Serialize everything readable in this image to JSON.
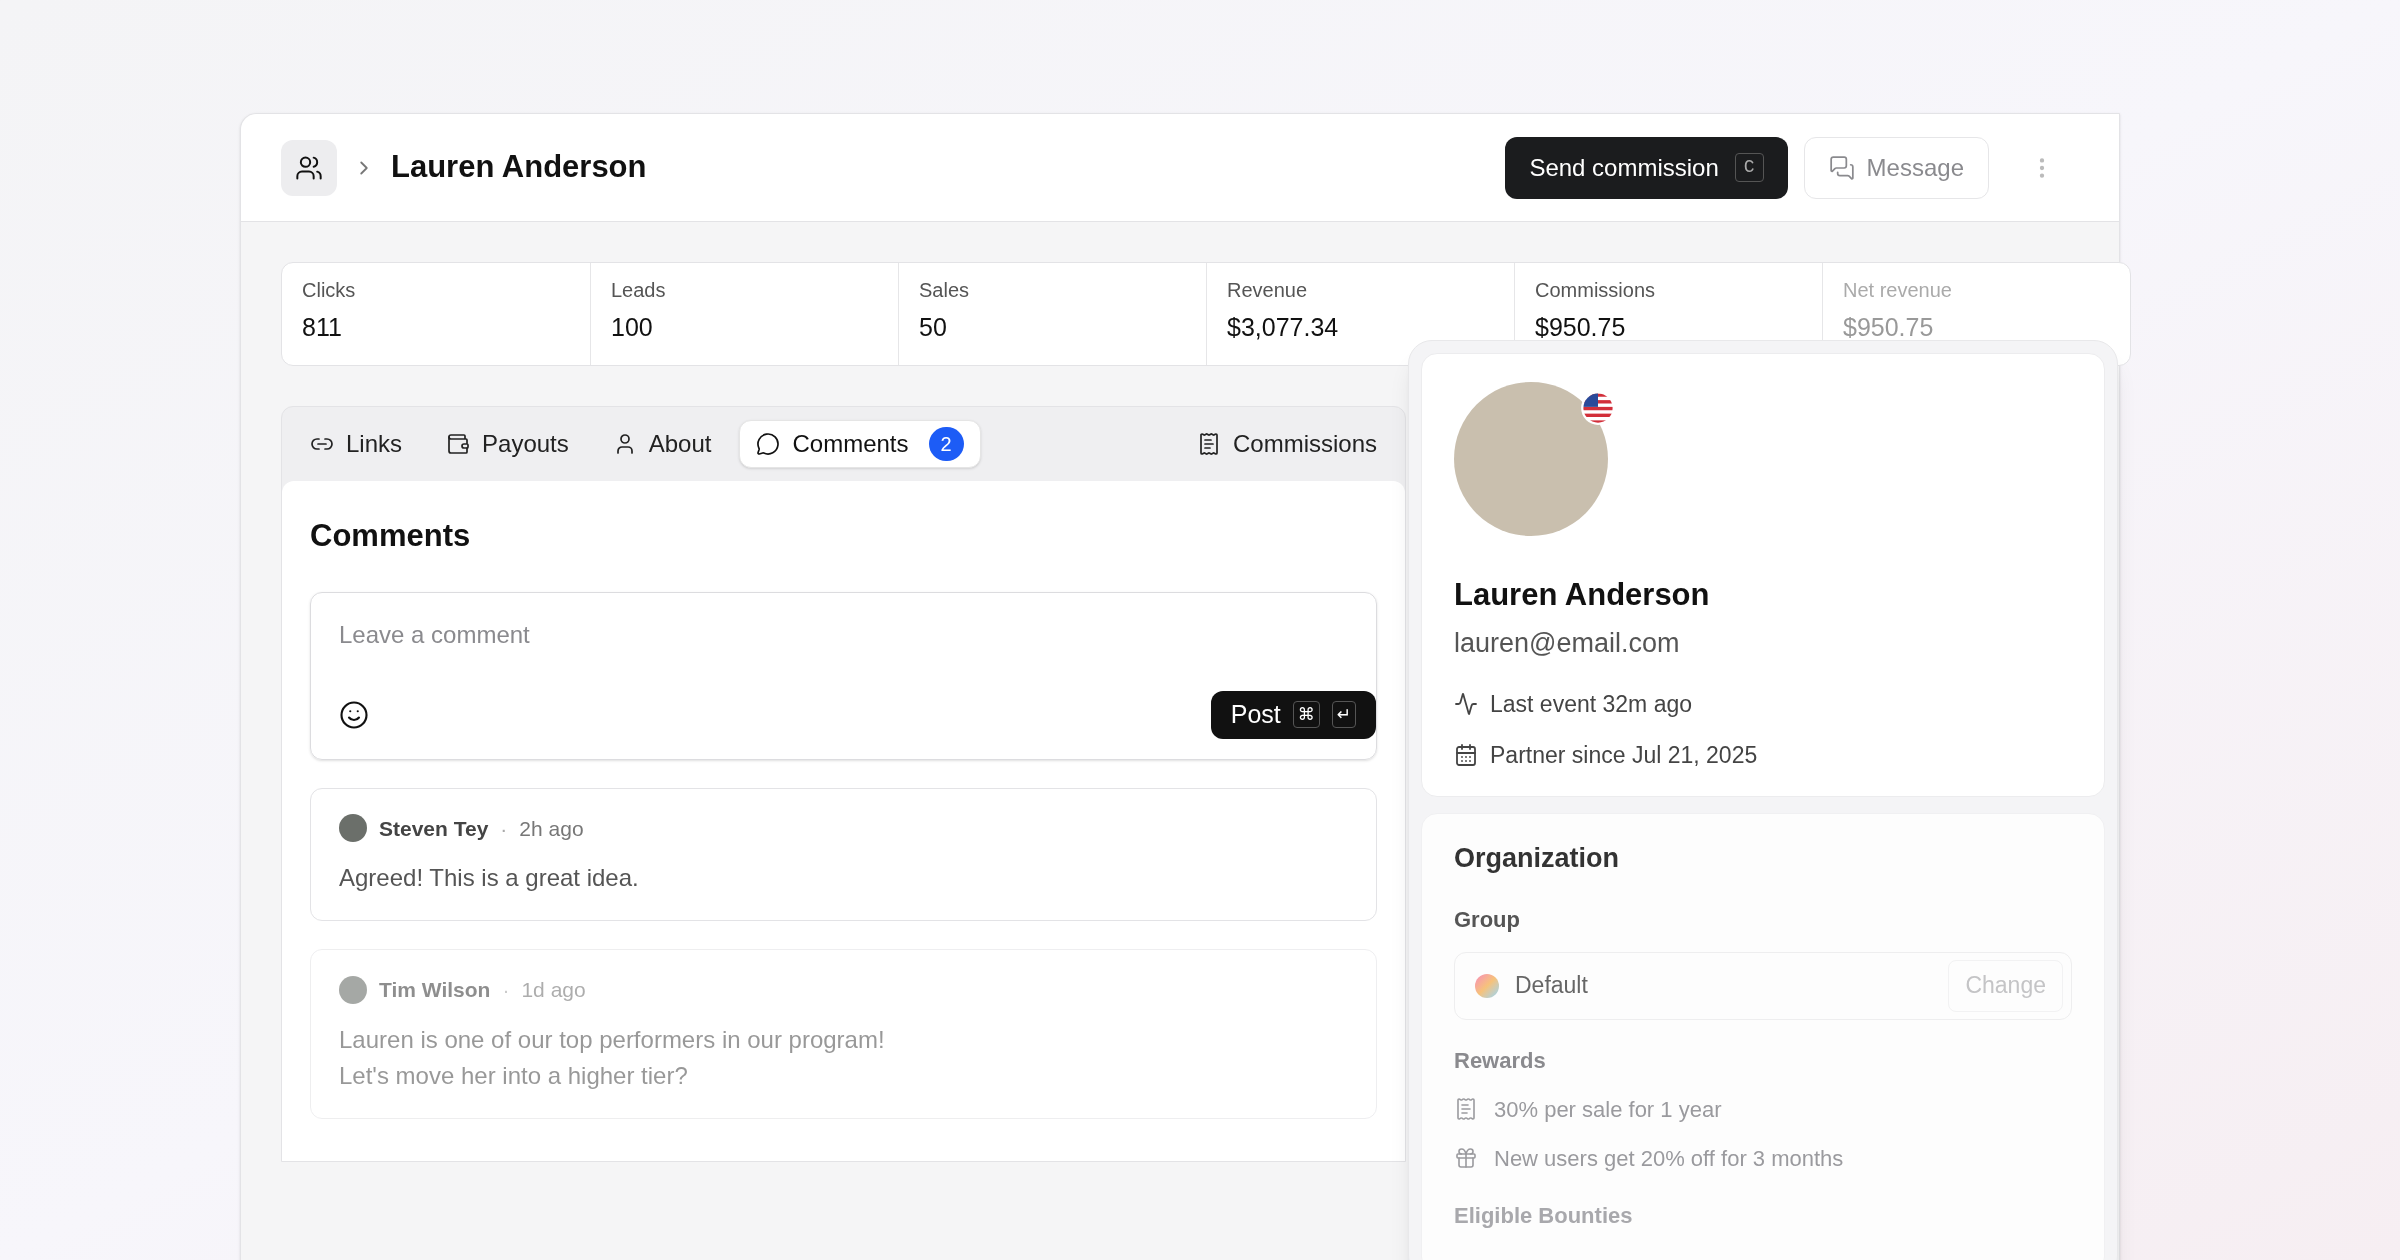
{
  "header": {
    "breadcrumb_title": "Lauren Anderson",
    "primary_button": {
      "label": "Send commission",
      "shortcut": "C"
    },
    "secondary_button": {
      "label": "Message"
    }
  },
  "stats": [
    {
      "label": "Clicks",
      "value": "811"
    },
    {
      "label": "Leads",
      "value": "100"
    },
    {
      "label": "Sales",
      "value": "50"
    },
    {
      "label": "Revenue",
      "value": "$3,077.34"
    },
    {
      "label": "Commissions",
      "value": "$950.75"
    },
    {
      "label": "Net revenue",
      "value": "$950.75"
    }
  ],
  "tabs": [
    {
      "kind": "links",
      "label": "Links",
      "selected": false
    },
    {
      "kind": "payouts",
      "label": "Payouts",
      "selected": false
    },
    {
      "kind": "about",
      "label": "About",
      "selected": false
    },
    {
      "kind": "comments",
      "label": "Comments",
      "badge": "2",
      "selected": true
    },
    {
      "kind": "commissions",
      "label": "Commissions",
      "selected": false
    }
  ],
  "comments_section": {
    "title": "Comments",
    "composer": {
      "placeholder": "Leave a comment",
      "post_label": "Post",
      "shortcut_keys": [
        "⌘",
        "↵"
      ]
    },
    "separator": "·",
    "comments": [
      {
        "author": "Steven Tey",
        "time": "2h ago",
        "text_lines": [
          "Agreed! This is a great idea."
        ]
      },
      {
        "author": "Tim Wilson",
        "time": "1d ago",
        "text_lines": [
          "Lauren is one of our top performers in our program!",
          "Let's move her into a higher tier?"
        ]
      }
    ]
  },
  "profile": {
    "name": "Lauren Anderson",
    "email": "lauren@email.com",
    "last_event": "Last event 32m ago",
    "partner_since": "Partner since Jul 21, 2025"
  },
  "organization": {
    "title": "Organization",
    "group_label": "Group",
    "group_value": "Default",
    "change_label": "Change",
    "rewards_label": "Rewards",
    "rewards": [
      {
        "kind": "sale",
        "text": "30% per sale for 1 year"
      },
      {
        "kind": "discount",
        "text": "New users get 20% off for 3 months"
      }
    ],
    "bounties_label": "Eligible Bounties"
  }
}
